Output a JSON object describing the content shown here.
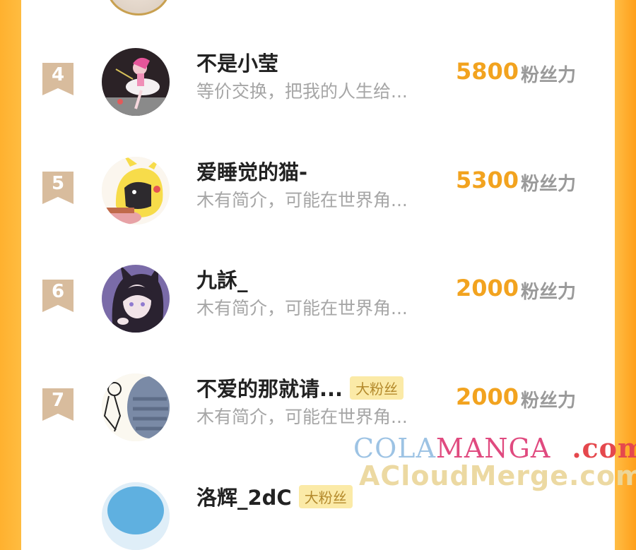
{
  "fans": [
    {
      "rank": "4",
      "name": "不是小莹",
      "bio": "等价交换，把我的人生给...",
      "score": "5800",
      "unit": "粉丝力",
      "badge": "",
      "avatar_icon": "pink-dancer-avatar"
    },
    {
      "rank": "5",
      "name": "爱睡觉的猫-",
      "bio": "木有简介，可能在世界角...",
      "score": "5300",
      "unit": "粉丝力",
      "badge": "",
      "avatar_icon": "pikachu-hood-avatar"
    },
    {
      "rank": "6",
      "name": "九訸_",
      "bio": "木有简介，可能在世界角...",
      "score": "2000",
      "unit": "粉丝力",
      "badge": "",
      "avatar_icon": "cat-ear-girl-avatar"
    },
    {
      "rank": "7",
      "name": "不爱的那就请...",
      "bio": "木有简介，可能在世界角...",
      "score": "2000",
      "unit": "粉丝力",
      "badge": "大粉丝",
      "avatar_icon": "sketch-character-avatar"
    },
    {
      "rank": "",
      "name": "洛辉_2dC",
      "bio": "",
      "score": "",
      "unit": "",
      "badge": "大粉丝",
      "avatar_icon": "blue-hair-avatar"
    }
  ],
  "watermark": {
    "line1_a": "COLA",
    "line1_b": "MANGA",
    "line1_c": ".com",
    "line2": "ACloudMerge.com"
  },
  "colors": {
    "score": "#f2a31f",
    "rank_flag": "#d8bc9d",
    "badge_bg": "#fbeaa7",
    "side_orange": "#ffb12f"
  }
}
